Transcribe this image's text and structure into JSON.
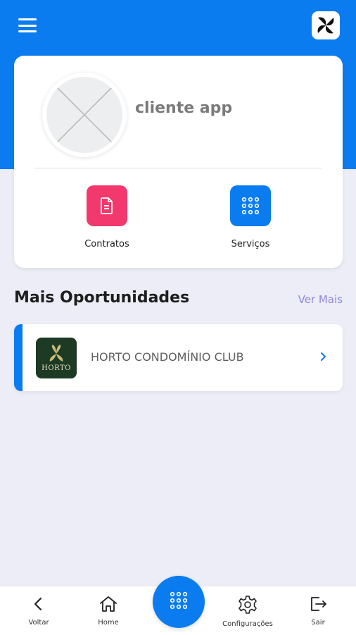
{
  "header": {
    "menu_icon": "hamburger-menu-icon",
    "logo_icon": "pinwheel-logo-icon",
    "accent_color": "#0A7CF0"
  },
  "profile": {
    "name": "cliente app",
    "avatar_icon": "avatar-placeholder-icon"
  },
  "actions": [
    {
      "label": "Contratos",
      "icon": "document-icon",
      "color": "#F3386E"
    },
    {
      "label": "Serviços",
      "icon": "grid-dots-icon",
      "color": "#0A7CF0"
    }
  ],
  "opportunities": {
    "title": "Mais Oportunidades",
    "see_more": "Ver Mais",
    "items": [
      {
        "name": "HORTO CONDOMÍNIO CLUB",
        "logo_text": "HORTO"
      }
    ]
  },
  "bottom_nav": {
    "items": [
      {
        "label": "Voltar",
        "icon": "chevron-left-icon"
      },
      {
        "label": "Home",
        "icon": "home-icon"
      },
      {
        "label": "Configurações",
        "icon": "gear-icon"
      },
      {
        "label": "Sair",
        "icon": "logout-icon"
      }
    ],
    "center_icon": "grid-dots-icon"
  }
}
